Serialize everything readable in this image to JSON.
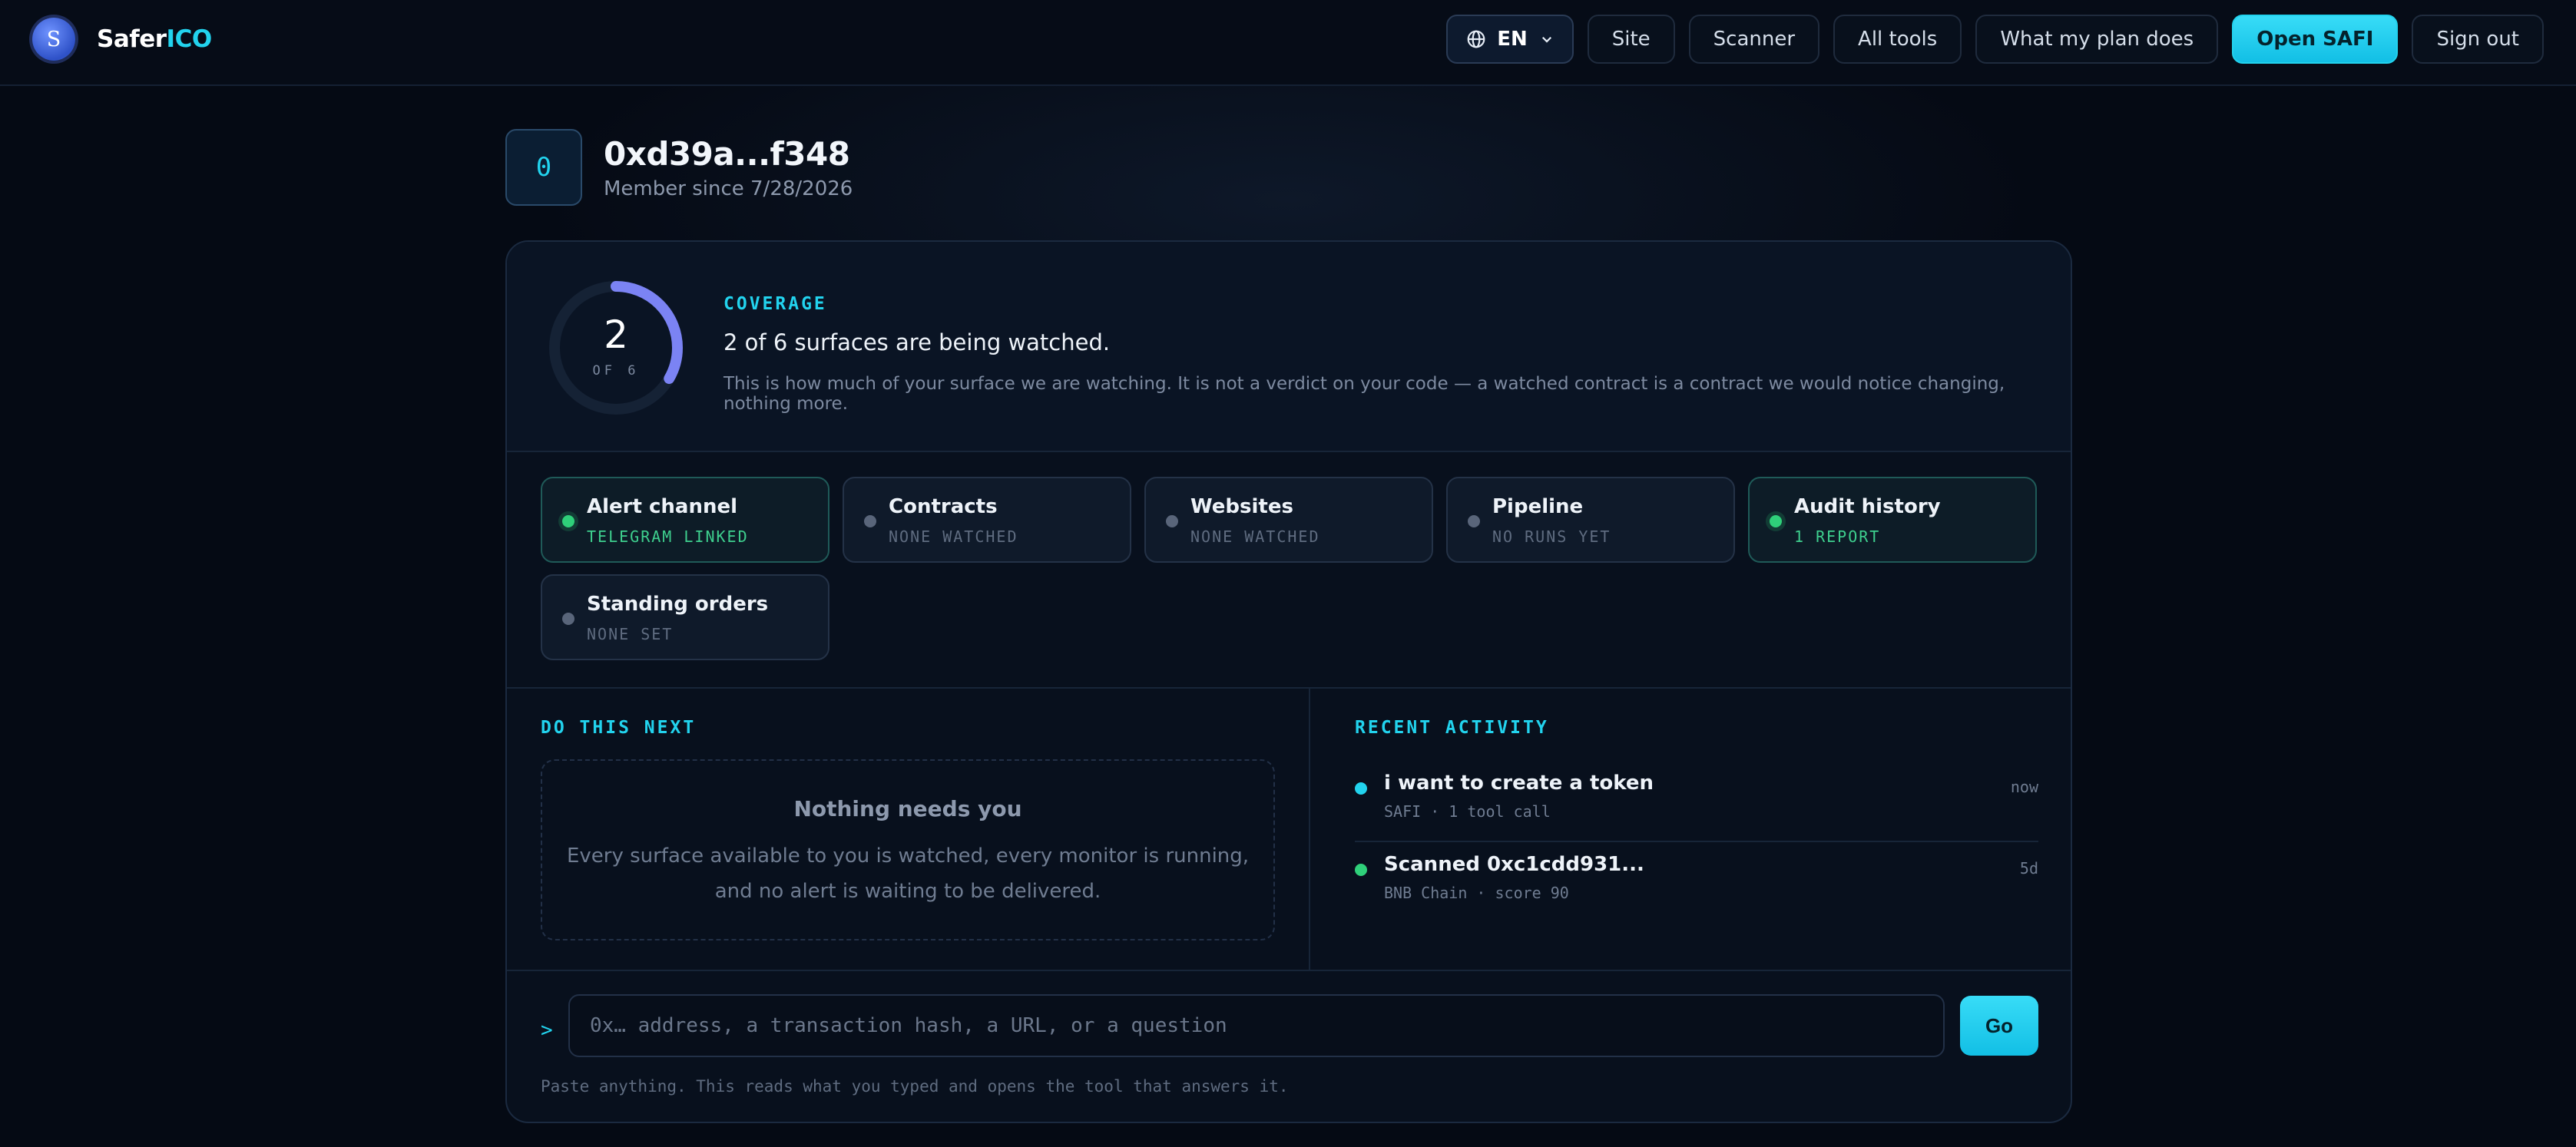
{
  "brand": {
    "logo_letter": "S",
    "name_part1": "Safer",
    "name_part2": "ICO",
    "accent": "#22d3ee"
  },
  "nav": {
    "language": "EN",
    "items": [
      "Site",
      "Scanner",
      "All tools",
      "What my plan does"
    ],
    "primary": "Open SAFI",
    "sign_out": "Sign out"
  },
  "profile": {
    "avatar_char": "0",
    "address": "0xd39a...f348",
    "member_since": "Member since 7/28/2026"
  },
  "coverage": {
    "watched": 2,
    "total": 6,
    "watched_label": "2",
    "of_label": "OF 6",
    "label": "COVERAGE",
    "title": "2 of 6 surfaces are being watched.",
    "description": "This is how much of your surface we are watching. It is not a verdict on your code — a watched contract is a contract we would notice changing, nothing more."
  },
  "surfaces": [
    {
      "title": "Alert channel",
      "status": "TELEGRAM LINKED",
      "active": true
    },
    {
      "title": "Contracts",
      "status": "NONE WATCHED",
      "active": false
    },
    {
      "title": "Websites",
      "status": "NONE WATCHED",
      "active": false
    },
    {
      "title": "Pipeline",
      "status": "NO RUNS YET",
      "active": false
    },
    {
      "title": "Audit history",
      "status": "1 REPORT",
      "active": true
    },
    {
      "title": "Standing orders",
      "status": "NONE SET",
      "active": false
    }
  ],
  "next": {
    "label": "DO THIS NEXT",
    "empty_title": "Nothing needs you",
    "empty_desc": "Every surface available to you is watched, every monitor is running, and no alert is waiting to be delivered."
  },
  "activity": {
    "label": "RECENT ACTIVITY",
    "items": [
      {
        "title": "i want to create a token",
        "meta": "SAFI · 1 tool call",
        "time": "now",
        "color": "#22d3ee"
      },
      {
        "title": "Scanned 0xc1cdd931...",
        "meta": "BNB Chain · score 90",
        "time": "5d",
        "color": "#2fd07a"
      }
    ]
  },
  "command": {
    "prompt": ">",
    "placeholder": "0x… address, a transaction hash, a URL, or a question",
    "value": "",
    "go": "Go",
    "hint": "Paste anything. This reads what you typed and opens the tool that answers it."
  }
}
